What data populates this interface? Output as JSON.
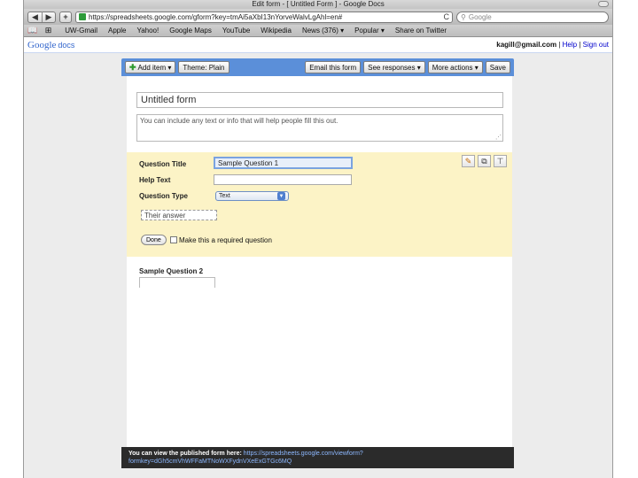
{
  "window": {
    "title": "Edit form - [ Untitled Form ] - Google Docs"
  },
  "toolbar": {
    "back_glyph": "◀",
    "forward_glyph": "▶",
    "plus_glyph": "+",
    "url": "https://spreadsheets.google.com/gform?key=tmAi5aXbI13nYorveWalvLgAhl=en#",
    "reload_glyph": "C",
    "search_placeholder": "Google"
  },
  "bookmarks": {
    "icons": "📖 ⊞",
    "items": [
      "UW-Gmail",
      "Apple",
      "Yahoo!",
      "Google Maps",
      "YouTube",
      "Wikipedia",
      "News (376) ▾",
      "Popular ▾",
      "Share on Twitter"
    ]
  },
  "docs_header": {
    "logo_google": "Google",
    "logo_docs": "docs",
    "user_email": "kagill@gmail.com",
    "separator": "|",
    "help": "Help",
    "sign_out": "Sign out"
  },
  "form_toolbar": {
    "add_item": "Add item ▾",
    "theme": "Theme: Plain",
    "email_form": "Email this form",
    "see_responses": "See responses ▾",
    "more_actions": "More actions ▾",
    "save": "Save"
  },
  "form": {
    "title_value": "Untitled form",
    "description_value": "You can include any text or info that will help people fill this out.",
    "question1": {
      "title_label": "Question Title",
      "title_value": "Sample Question 1",
      "help_label": "Help Text",
      "help_value": "",
      "type_label": "Question Type",
      "type_value": "Text",
      "answer_preview": "Their answer",
      "done_label": "Done",
      "required_label": "Make this a required question"
    },
    "question2": {
      "title": "Sample Question 2"
    }
  },
  "publish_bar": {
    "text": "You can view the published form here:",
    "url": "https://spreadsheets.google.com/viewform?formkey=dGh5cmVhWFFaMTNoWXFydnVXeExGTGc6MQ"
  },
  "colors": {
    "form_toolbar_bg": "#5b8fd9",
    "question_edit_bg": "#fcf3c6",
    "publish_bar_bg": "#2b2b2b",
    "link": "#0000cc"
  }
}
